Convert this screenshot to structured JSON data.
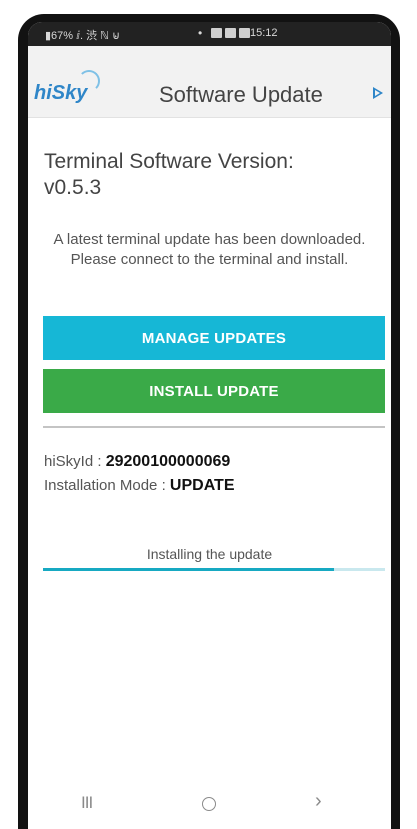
{
  "status_bar": {
    "left_text": "▮67% ⅈ. 渋 ℕ ⊌",
    "dot": "•",
    "time": "15:12"
  },
  "app_bar": {
    "logo_text": "hiSky",
    "title": "Software Update",
    "action_icon": "play-arrow-icon",
    "brand_color": "#2f86c8"
  },
  "content": {
    "version_label": "Terminal Software Version:",
    "version_value": "v0.5.3",
    "info_message": "A latest terminal update has been downloaded. Please connect to the terminal and install.",
    "manage_button": "MANAGE UPDATES",
    "install_button": "INSTALL UPDATE",
    "manage_color": "#16b7d6",
    "install_color": "#3aaa48",
    "hisky_id_label": "hiSkyId : ",
    "hisky_id_value": "29200100000069",
    "install_mode_label": "Installation Mode : ",
    "install_mode_value": "UPDATE",
    "progress_label": "Installing the update",
    "progress_fraction": 0.85
  },
  "nav_bar": {
    "recent": "III",
    "home_icon": "home-circle-icon",
    "back": "›"
  }
}
